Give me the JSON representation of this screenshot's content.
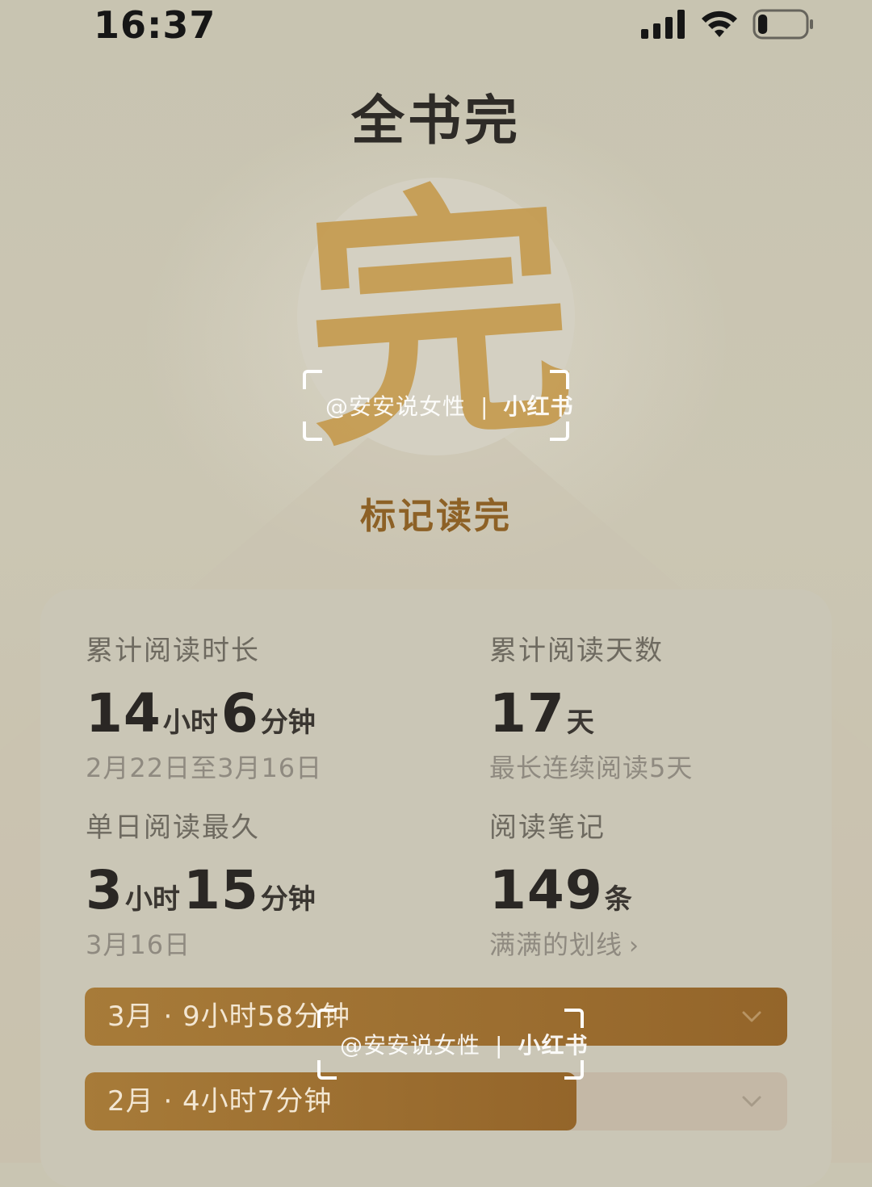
{
  "status_bar": {
    "time": "16:37",
    "icons": [
      "cellular-signal-icon",
      "wifi-icon",
      "battery-icon"
    ],
    "battery_level": 0.2
  },
  "header": {
    "title": "全书完",
    "seal_character": "完",
    "seal_color": "#c59a4d",
    "mark_done_label": "标记读完"
  },
  "stats": {
    "total_time": {
      "label": "累计阅读时长",
      "hours": "14",
      "hours_unit": "小时",
      "minutes": "6",
      "minutes_unit": "分钟",
      "sub": "2月22日至3月16日"
    },
    "total_days": {
      "label": "累计阅读天数",
      "value": "17",
      "unit": "天",
      "sub": "最长连续阅读5天"
    },
    "longest_day": {
      "label": "单日阅读最久",
      "hours": "3",
      "hours_unit": "小时",
      "minutes": "15",
      "minutes_unit": "分钟",
      "sub": "3月16日"
    },
    "notes": {
      "label": "阅读笔记",
      "value": "149",
      "unit": "条",
      "sub": "满满的划线"
    }
  },
  "months": [
    {
      "label": "3月 · 9小时58分钟",
      "fill_fraction": 1.0
    },
    {
      "label": "2月 · 4小时7分钟",
      "fill_fraction": 0.7
    }
  ],
  "watermark": {
    "handle": "@安安说女性",
    "separator": "|",
    "brand": "小红书"
  },
  "colors": {
    "background": "#c9c5b2",
    "accent_gold": "#8d6126",
    "bar_fill": "#9c6d2f",
    "bar_track": "#c4b8a6"
  }
}
